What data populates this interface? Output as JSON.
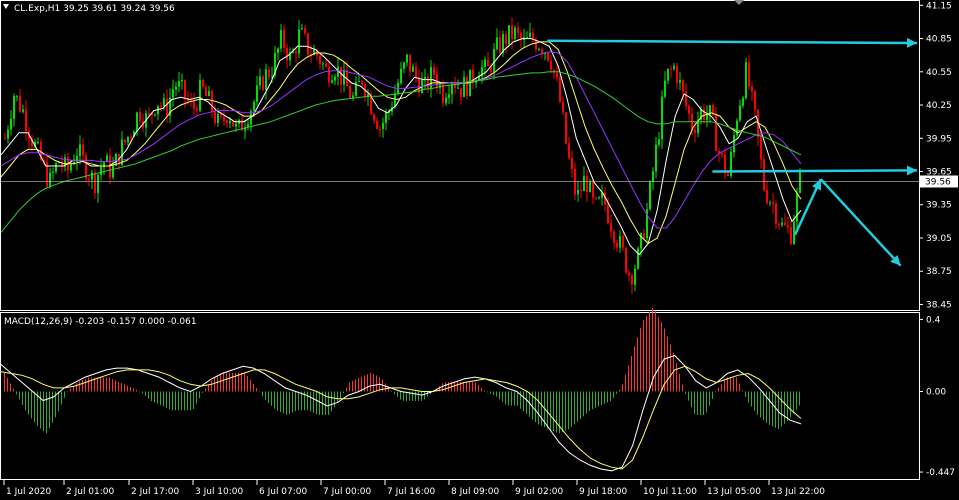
{
  "header": {
    "symbol_line": "CL.Exp,H1  39.25 39.61 39.24 39.56",
    "macd_line": "MACD(12,26,9) -0.203 -0.157 0.000 -0.061"
  },
  "colors": {
    "background": "#000000",
    "frame": "#ffffff",
    "bull_candle": "#00e000",
    "bear_candle": "#ff0000",
    "ma_fast": "#ffffff",
    "ma_mid": "#ffff66",
    "ma_slow": "#9933ff",
    "ma_long": "#33cc33",
    "annotation": "#22ccdd",
    "price_line": "#c0c0c0",
    "macd_hist_pos": "#ff3333",
    "macd_hist_neg": "#33aa33",
    "macd_line": "#ffffff",
    "signal_line": "#ffff66"
  },
  "chart_data": [
    {
      "type": "candlestick",
      "symbol": "CL.Exp",
      "timeframe": "H1",
      "last_price": "39.56",
      "ylim": [
        38.4,
        41.18
      ],
      "y_ticks": [
        "41.15",
        "40.85",
        "40.55",
        "40.25",
        "39.95",
        "39.65",
        "39.35",
        "39.05",
        "38.75",
        "38.45"
      ],
      "y_tick_values": [
        41.15,
        40.85,
        40.55,
        40.25,
        39.95,
        39.65,
        39.35,
        39.05,
        38.75,
        38.45
      ],
      "x_labels": [
        "1 Jul 2020",
        "2 Jul 01:00",
        "2 Jul 17:00",
        "3 Jul 10:00",
        "6 Jul 07:00",
        "7 Jul 00:00",
        "7 Jul 16:00",
        "8 Jul 09:00",
        "9 Jul 02:00",
        "9 Jul 18:00",
        "10 Jul 11:00",
        "13 Jul 05:00",
        "13 Jul 22:00"
      ],
      "close_path": [
        39.95,
        40.35,
        40.2,
        39.95,
        39.75,
        39.55,
        39.75,
        39.65,
        39.85,
        39.7,
        39.55,
        39.75,
        39.65,
        39.85,
        40.0,
        40.2,
        40.1,
        40.3,
        40.2,
        40.45,
        40.35,
        40.2,
        40.4,
        40.25,
        40.05,
        40.2,
        40.0,
        40.15,
        40.3,
        40.5,
        40.6,
        40.85,
        40.65,
        40.9,
        40.75,
        40.7,
        40.55,
        40.6,
        40.45,
        40.3,
        40.5,
        40.25,
        40.05,
        40.2,
        40.45,
        40.65,
        40.5,
        40.4,
        40.55,
        40.35,
        40.5,
        40.4,
        40.45,
        40.6,
        40.55,
        40.75,
        40.85,
        40.9,
        40.8,
        40.85,
        40.8,
        40.7,
        40.35,
        39.8,
        39.4,
        39.6,
        39.3,
        39.4,
        39.15,
        38.95,
        38.7,
        38.9,
        39.35,
        39.9,
        40.5,
        40.6,
        40.3,
        40.05,
        40.2,
        40.15,
        39.8,
        39.6,
        40.2,
        40.55,
        40.1,
        39.5,
        39.35,
        39.15,
        39.1,
        39.56
      ],
      "moving_averages": [
        {
          "values": [
            39.8,
            39.9,
            40.0,
            40.0,
            39.85,
            39.7,
            39.7,
            39.7,
            39.75,
            39.75,
            39.7,
            39.7,
            39.7,
            39.75,
            39.85,
            40.0,
            40.1,
            40.2,
            40.22,
            40.3,
            40.32,
            40.3,
            40.32,
            40.28,
            40.2,
            40.15,
            40.1,
            40.1,
            40.15,
            40.3,
            40.45,
            40.65,
            40.7,
            40.78,
            40.78,
            40.75,
            40.68,
            40.6,
            40.52,
            40.45,
            40.42,
            40.35,
            40.22,
            40.18,
            40.25,
            40.4,
            40.5,
            40.48,
            40.48,
            40.45,
            40.45,
            40.45,
            40.45,
            40.5,
            40.55,
            40.65,
            40.75,
            40.82,
            40.85,
            40.85,
            40.82,
            40.78,
            40.6,
            40.3,
            39.95,
            39.75,
            39.55,
            39.45,
            39.3,
            39.15,
            38.98,
            38.9,
            39.0,
            39.3,
            39.75,
            40.15,
            40.35,
            40.3,
            40.2,
            40.15,
            40.05,
            39.9,
            39.95,
            40.1,
            40.15,
            39.9,
            39.65,
            39.4,
            39.2,
            39.3
          ]
        },
        {
          "values": [
            39.6,
            39.7,
            39.8,
            39.85,
            39.85,
            39.8,
            39.75,
            39.72,
            39.72,
            39.74,
            39.72,
            39.7,
            39.7,
            39.72,
            39.75,
            39.82,
            39.9,
            40.0,
            40.1,
            40.2,
            40.25,
            40.28,
            40.3,
            40.3,
            40.28,
            40.25,
            40.2,
            40.15,
            40.15,
            40.2,
            40.3,
            40.4,
            40.52,
            40.62,
            40.68,
            40.72,
            40.72,
            40.7,
            40.65,
            40.58,
            40.52,
            40.45,
            40.38,
            40.32,
            40.3,
            40.32,
            40.38,
            40.42,
            40.45,
            40.45,
            40.45,
            40.45,
            40.45,
            40.47,
            40.5,
            40.55,
            40.62,
            40.7,
            40.76,
            40.8,
            40.82,
            40.82,
            40.75,
            40.55,
            40.3,
            40.05,
            39.85,
            39.68,
            39.52,
            39.38,
            39.22,
            39.08,
            39.0,
            39.05,
            39.25,
            39.55,
            39.85,
            40.05,
            40.15,
            40.18,
            40.15,
            40.05,
            40.0,
            40.05,
            40.1,
            40.05,
            39.9,
            39.72,
            39.52,
            39.4
          ]
        },
        {
          "values": [
            39.7,
            39.75,
            39.8,
            39.82,
            39.82,
            39.8,
            39.78,
            39.76,
            39.75,
            39.75,
            39.75,
            39.74,
            39.74,
            39.75,
            39.76,
            39.8,
            39.85,
            39.9,
            39.96,
            40.02,
            40.08,
            40.12,
            40.16,
            40.18,
            40.2,
            40.2,
            40.2,
            40.18,
            40.18,
            40.2,
            40.24,
            40.3,
            40.36,
            40.42,
            40.48,
            40.52,
            40.55,
            40.56,
            40.56,
            40.54,
            40.52,
            40.5,
            40.46,
            40.42,
            40.4,
            40.4,
            40.41,
            40.42,
            40.43,
            40.44,
            40.45,
            40.45,
            40.46,
            40.47,
            40.49,
            40.52,
            40.56,
            40.6,
            40.64,
            40.68,
            40.71,
            40.73,
            40.72,
            40.64,
            40.5,
            40.34,
            40.18,
            40.02,
            39.86,
            39.7,
            39.54,
            39.38,
            39.24,
            39.14,
            39.14,
            39.24,
            39.38,
            39.52,
            39.65,
            39.75,
            39.82,
            39.86,
            39.9,
            39.94,
            39.98,
            40.0,
            39.98,
            39.92,
            39.82,
            39.72
          ]
        },
        {
          "values": [
            39.1,
            39.2,
            39.3,
            39.38,
            39.45,
            39.5,
            39.53,
            39.56,
            39.58,
            39.6,
            39.62,
            39.64,
            39.66,
            39.68,
            39.7,
            39.72,
            39.75,
            39.78,
            39.81,
            39.84,
            39.88,
            39.91,
            39.94,
            39.96,
            39.98,
            40.0,
            40.02,
            40.04,
            40.06,
            40.08,
            40.1,
            40.13,
            40.16,
            40.19,
            40.22,
            40.25,
            40.27,
            40.29,
            40.3,
            40.31,
            40.32,
            40.33,
            40.33,
            40.34,
            40.35,
            40.36,
            40.37,
            40.39,
            40.4,
            40.42,
            40.43,
            40.44,
            40.46,
            40.47,
            40.48,
            40.5,
            40.51,
            40.52,
            40.53,
            40.54,
            40.54,
            40.55,
            40.55,
            40.53,
            40.5,
            40.46,
            40.42,
            40.37,
            40.32,
            40.26,
            40.2,
            40.14,
            40.1,
            40.08,
            40.08,
            40.1,
            40.1,
            40.1,
            40.1,
            40.1,
            40.08,
            40.05,
            40.02,
            40.0,
            39.98,
            39.96,
            39.92,
            39.88,
            39.84,
            39.8
          ]
        }
      ],
      "hlines": [
        39.56
      ],
      "annotations": [
        {
          "type": "arrow",
          "from": [
            0.595,
            40.83
          ],
          "to": [
            1.0,
            40.81
          ]
        },
        {
          "type": "arrow",
          "from": [
            0.775,
            39.65
          ],
          "to": [
            1.0,
            39.66
          ]
        },
        {
          "type": "arrow",
          "from": [
            0.865,
            39.08
          ],
          "to": [
            0.893,
            39.58
          ]
        },
        {
          "type": "arrow",
          "from": [
            0.893,
            39.58
          ],
          "to": [
            0.98,
            38.8
          ]
        }
      ]
    },
    {
      "type": "macd",
      "params": "12,26,9",
      "ylim": [
        -0.48,
        0.43
      ],
      "y_ticks": [
        "0.4",
        "0.00",
        "-0.447"
      ],
      "y_tick_values": [
        0.4,
        0.0,
        -0.447
      ],
      "macd_line": [
        0.15,
        0.1,
        0.05,
        0.0,
        -0.05,
        -0.03,
        0.02,
        0.05,
        0.08,
        0.1,
        0.12,
        0.13,
        0.13,
        0.12,
        0.1,
        0.08,
        0.05,
        0.02,
        0.0,
        0.03,
        0.07,
        0.1,
        0.12,
        0.14,
        0.13,
        0.1,
        0.06,
        0.02,
        0.0,
        -0.02,
        -0.05,
        -0.08,
        -0.06,
        -0.02,
        0.0,
        0.03,
        0.04,
        0.02,
        0.0,
        -0.01,
        -0.02,
        0.0,
        0.03,
        0.05,
        0.07,
        0.08,
        0.07,
        0.05,
        0.02,
        0.0,
        -0.05,
        -0.12,
        -0.2,
        -0.28,
        -0.34,
        -0.38,
        -0.41,
        -0.43,
        -0.44,
        -0.42,
        -0.3,
        -0.1,
        0.08,
        0.18,
        0.2,
        0.14,
        0.06,
        0.02,
        0.05,
        0.1,
        0.12,
        0.08,
        0.02,
        -0.05,
        -0.12,
        -0.16,
        -0.18
      ],
      "signal_line": [
        0.11,
        0.1,
        0.09,
        0.07,
        0.04,
        0.02,
        0.02,
        0.03,
        0.05,
        0.07,
        0.09,
        0.11,
        0.12,
        0.12,
        0.12,
        0.11,
        0.09,
        0.06,
        0.04,
        0.03,
        0.04,
        0.06,
        0.08,
        0.1,
        0.12,
        0.12,
        0.1,
        0.07,
        0.04,
        0.02,
        0.0,
        -0.03,
        -0.04,
        -0.04,
        -0.03,
        -0.01,
        0.01,
        0.02,
        0.02,
        0.01,
        0.0,
        0.0,
        0.01,
        0.03,
        0.05,
        0.06,
        0.07,
        0.06,
        0.05,
        0.03,
        0.0,
        -0.05,
        -0.12,
        -0.19,
        -0.26,
        -0.32,
        -0.37,
        -0.4,
        -0.42,
        -0.43,
        -0.38,
        -0.25,
        -0.1,
        0.04,
        0.12,
        0.14,
        0.11,
        0.07,
        0.05,
        0.07,
        0.09,
        0.1,
        0.07,
        0.02,
        -0.04,
        -0.1,
        -0.15
      ]
    }
  ]
}
